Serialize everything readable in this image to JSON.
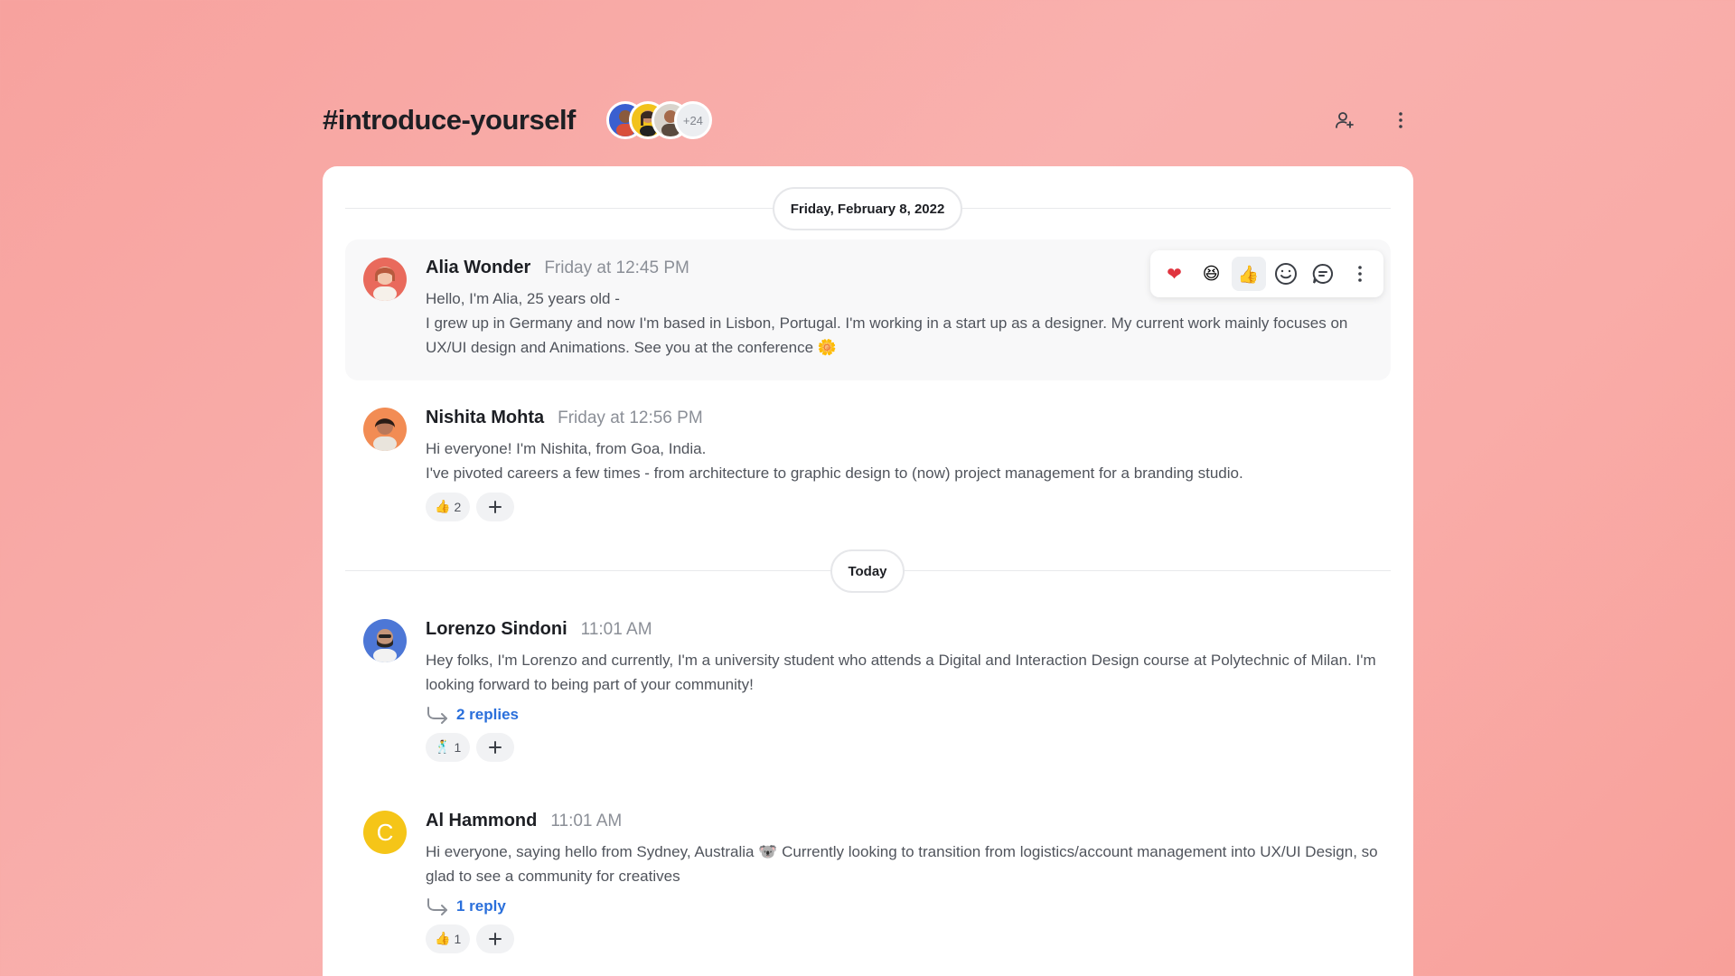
{
  "header": {
    "title": "#introduce-yourself",
    "member_extra": "+24"
  },
  "dividers": {
    "first_date": "Friday, February 8, 2022",
    "second_date": "Today"
  },
  "messages": [
    {
      "author": "Alia Wonder",
      "time": "Friday at 12:45 PM",
      "lines": [
        "Hello, I'm Alia, 25 years old -",
        "I grew up in Germany and now I'm based in Lisbon, Portugal. I'm working in a start up as a designer. My current work mainly focuses on UX/UI design and Animations. See you at the conference 🌼"
      ]
    },
    {
      "author": "Nishita Mohta",
      "time": "Friday at 12:56 PM",
      "lines": [
        "Hi everyone! I'm Nishita, from Goa, India.",
        "I've pivoted careers a few times - from architecture to graphic design to (now) project management for a branding studio."
      ],
      "reaction": {
        "emoji": "👍",
        "count": "2"
      }
    },
    {
      "author": "Lorenzo Sindoni",
      "time": "11:01 AM",
      "lines": [
        "Hey folks, I'm Lorenzo and currently, I'm a university student who attends a Digital and Interaction Design course at Polytechnic of Milan. I'm looking forward to being part of your community!"
      ],
      "replies": "2 replies",
      "reaction": {
        "emoji": "🕺",
        "count": "1"
      }
    },
    {
      "author": "Al Hammond",
      "avatar_letter": "C",
      "time": "11:01 AM",
      "lines": [
        "Hi everyone, saying hello from Sydney, Australia 🐨 Currently looking to transition from logistics/account management into UX/UI Design, so glad to see a community for creatives"
      ],
      "replies": "1 reply",
      "reaction": {
        "emoji": "👍",
        "count": "1"
      }
    }
  ],
  "toolbar": {
    "heart": "❤",
    "laugh": "😆",
    "thumbs": "👍"
  },
  "colors": {
    "accent_link": "#2a6fdb",
    "background_from": "#f7a29e",
    "background_to": "#f8a09a",
    "avatar_yellow": "#f5c518"
  },
  "icons": [
    "add-user-icon",
    "more-vertical-icon",
    "emoji-smile-icon",
    "reply-thread-icon",
    "reply-arrow-icon",
    "plus-icon"
  ]
}
